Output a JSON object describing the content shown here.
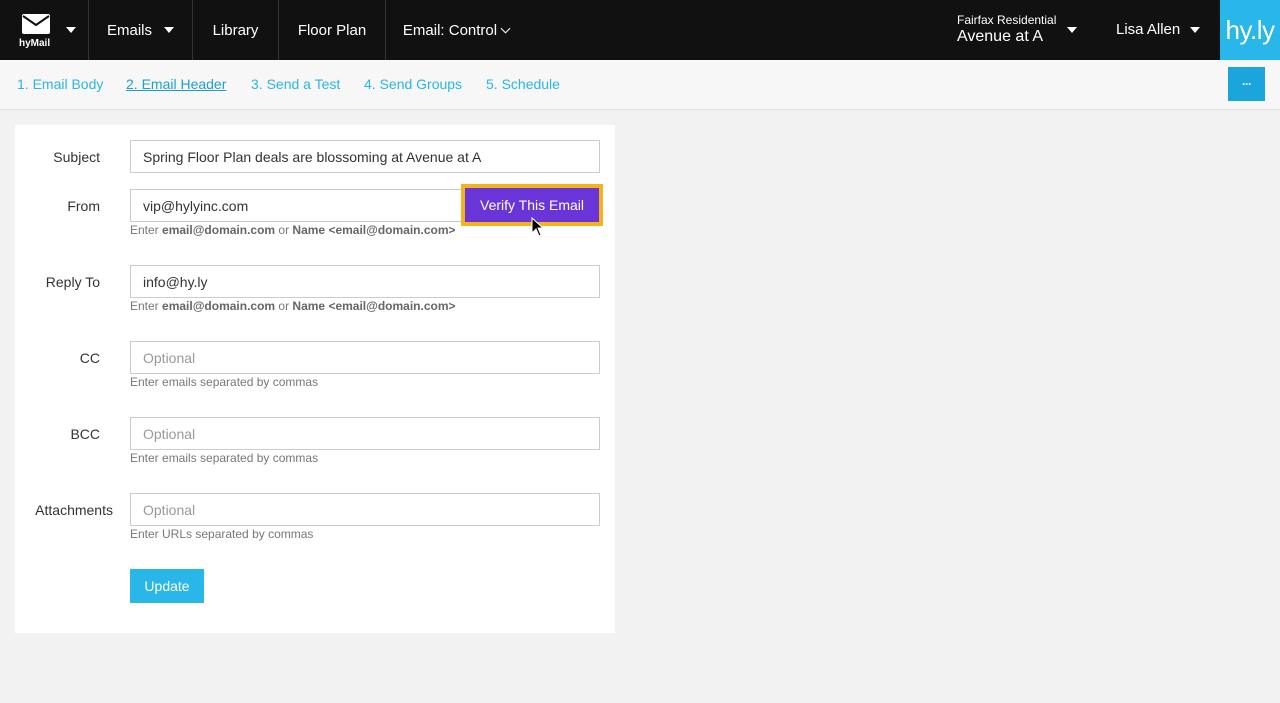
{
  "topbar": {
    "brand_label": "hyMail",
    "nav": {
      "emails": "Emails",
      "library": "Library",
      "floor_plan": "Floor Plan",
      "email_control": "Email: Control"
    },
    "company": "Fairfax Residential",
    "property": "Avenue at A",
    "user": "Lisa Allen",
    "logo": "hy.ly"
  },
  "steps": {
    "items": [
      "1. Email Body",
      "2. Email Header",
      "3. Send a Test",
      "4. Send Groups",
      "5. Schedule"
    ],
    "active_index": 1,
    "more_label": "···"
  },
  "form": {
    "subject": {
      "label": "Subject",
      "value": "Spring Floor Plan deals are blossoming at Avenue at A"
    },
    "from": {
      "label": "From",
      "value": "vip@hylyinc.com",
      "help_pre": "Enter ",
      "help_b1": "email@domain.com",
      "help_mid": " or ",
      "help_b2": "Name <email@domain.com>"
    },
    "verify_label": "Verify This Email",
    "reply_to": {
      "label": "Reply To",
      "value": "info@hy.ly",
      "help_pre": "Enter ",
      "help_b1": "email@domain.com",
      "help_mid": " or ",
      "help_b2": "Name <email@domain.com>"
    },
    "cc": {
      "label": "CC",
      "placeholder": "Optional",
      "help": "Enter emails separated by commas"
    },
    "bcc": {
      "label": "BCC",
      "placeholder": "Optional",
      "help": "Enter emails separated by commas"
    },
    "attachments": {
      "label": "Attachments",
      "placeholder": "Optional",
      "help": "Enter URLs separated by commas"
    },
    "update_label": "Update"
  },
  "colors": {
    "accent": "#29b6e8",
    "verify_bg": "#6a35d8",
    "highlight": "#f4b31a",
    "topbar_bg": "#111111"
  }
}
